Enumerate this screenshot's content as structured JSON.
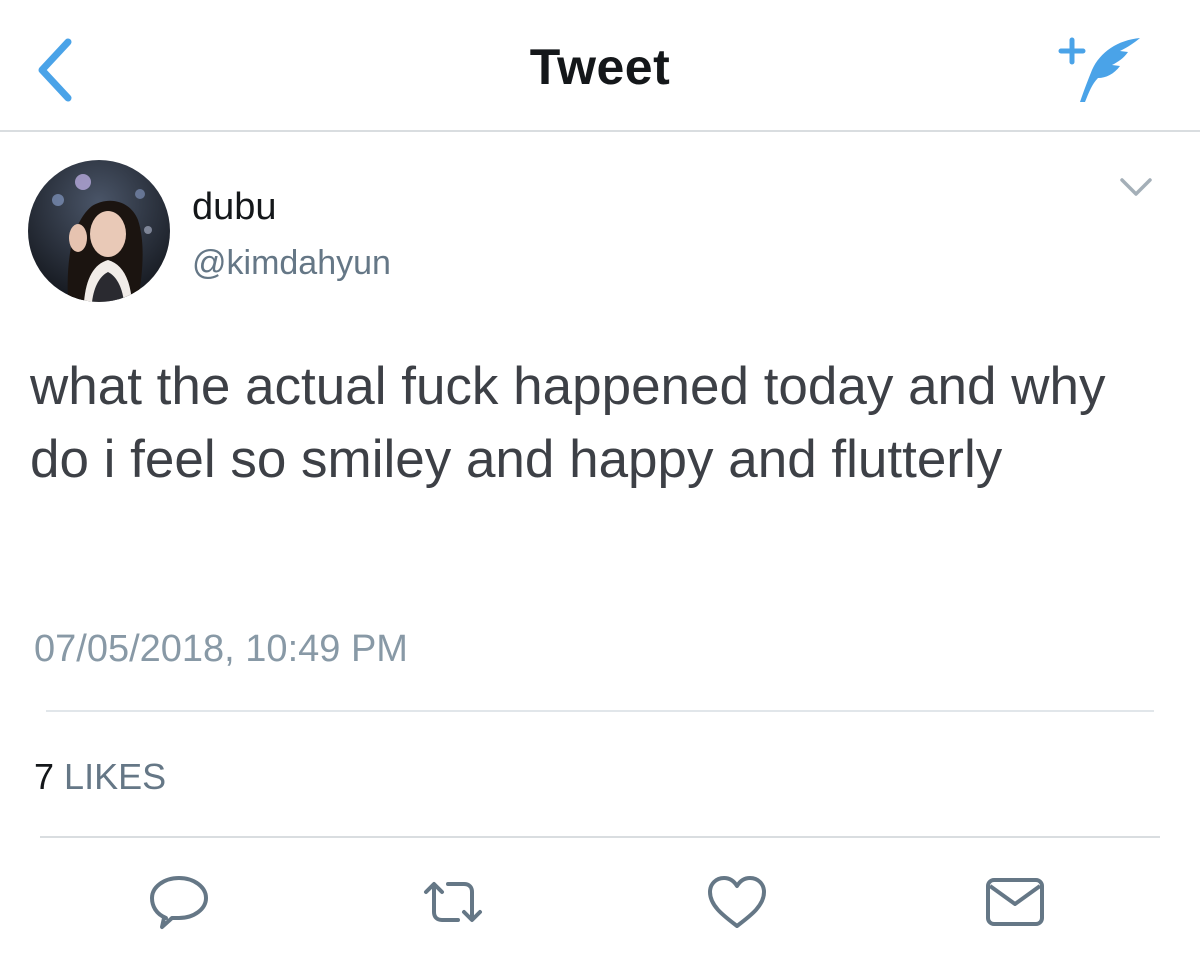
{
  "nav": {
    "title": "Tweet",
    "back_icon": "chevron-left-icon",
    "compose_icon": "compose-feather-icon"
  },
  "author": {
    "display_name": "dubu",
    "handle": "@kimdahyun",
    "avatar_icon": "profile-photo"
  },
  "tweet": {
    "text": "what the actual fuck happened today and why do i feel so smiley and happy and flutterly",
    "timestamp": "07/05/2018, 10:49 PM"
  },
  "stats": {
    "likes_count": "7",
    "likes_label": "LIKES"
  },
  "actions": [
    {
      "name": "reply",
      "icon": "reply-icon"
    },
    {
      "name": "retweet",
      "icon": "retweet-icon"
    },
    {
      "name": "like",
      "icon": "heart-icon"
    },
    {
      "name": "direct-message",
      "icon": "envelope-icon"
    }
  ],
  "colors": {
    "accent_blue": "#4aa3e8",
    "text_primary": "#14171a",
    "text_body": "#3d4046",
    "text_secondary": "#657786",
    "icon_gray": "#657786",
    "divider": "#e1e6ea"
  }
}
